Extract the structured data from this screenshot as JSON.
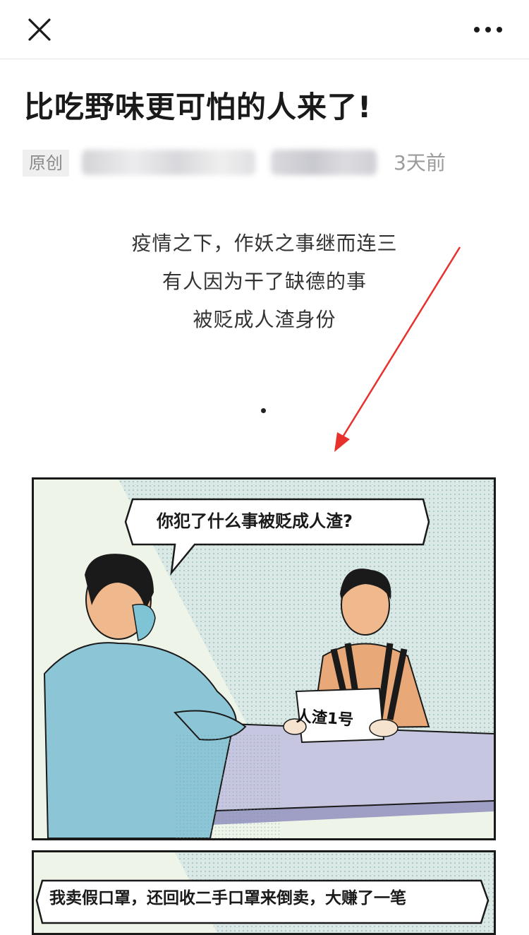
{
  "nav": {
    "close_icon": "close-icon",
    "more_icon": "more-dots-icon"
  },
  "article": {
    "title": "比吃野味更可怕的人来了!",
    "badge": "原创",
    "time": "3天前",
    "intro_lines": [
      "疫情之下，作妖之事继而连三",
      "有人因为干了缺德的事",
      "被贬成人渣身份"
    ]
  },
  "comic": {
    "panel1": {
      "bubble": "你犯了什么事被贬成人渣?",
      "sign": "人渣1号"
    },
    "panel2": {
      "bubble": "我卖假口罩，还回收二手口罩来倒卖，大赚了一笔"
    }
  },
  "colors": {
    "annotation_arrow": "#e8312c",
    "panel_bg": "#f2f7ee",
    "shirt_blue": "#8cc6d6",
    "prisoner_orange": "#e9a878"
  }
}
